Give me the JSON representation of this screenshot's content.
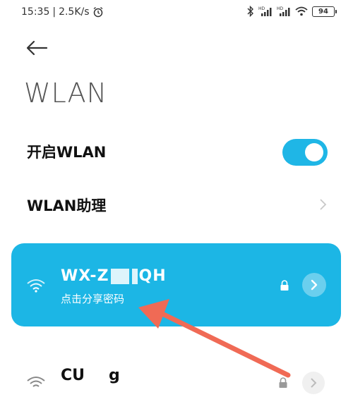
{
  "status_bar": {
    "time": "15:35",
    "net_speed": "2.5K/s",
    "battery": "94"
  },
  "header": {
    "title": "WLAN"
  },
  "settings": {
    "wlan_toggle_label": "开启WLAN",
    "wlan_toggle_on": true,
    "wlan_assistant_label": "WLAN助理"
  },
  "networks": [
    {
      "name_prefix": "WX-Z",
      "name_suffix": "QH",
      "subtitle": "点击分享密码",
      "secured": true,
      "connected": true
    },
    {
      "name_prefix": "CU",
      "name_suffix": "g",
      "secured": true,
      "connected": false
    }
  ],
  "colors": {
    "accent": "#1cb6e5",
    "annotation": "#f06a55"
  }
}
